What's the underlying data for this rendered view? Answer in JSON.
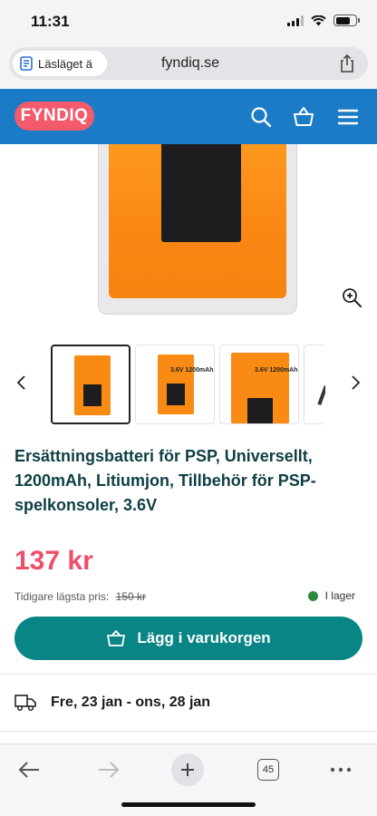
{
  "status_bar": {
    "time": "11:31"
  },
  "browser": {
    "reader_label": "Läsläget ä",
    "url": "fyndiq.se",
    "tab_count": "45"
  },
  "header": {
    "logo_text": "FYNDIQ",
    "colors": {
      "header_bg": "#1b7bc6",
      "logo_bg": "#f35b6d"
    }
  },
  "gallery": {
    "thumb_labels": [
      "",
      "3.6V 1200mAh",
      "3.6V 1200mAh",
      ""
    ]
  },
  "product": {
    "title": "Ersättningsbatteri för PSP, Universellt, 1200mAh, Litiumjon, Tillbehör för PSP-spelkonsoler, 3.6V",
    "price": "137 kr",
    "prev_price_label": "Tidigare lägsta pris:",
    "prev_price_value": "150 kr",
    "stock_status": "I lager",
    "add_to_cart": "Lägg i varukorgen",
    "delivery": "Fre, 23 jan - ons, 28 jan",
    "colors": {
      "price": "#ee4e6a",
      "cart_button": "#0a8585",
      "in_stock": "#2a8c3a"
    }
  }
}
